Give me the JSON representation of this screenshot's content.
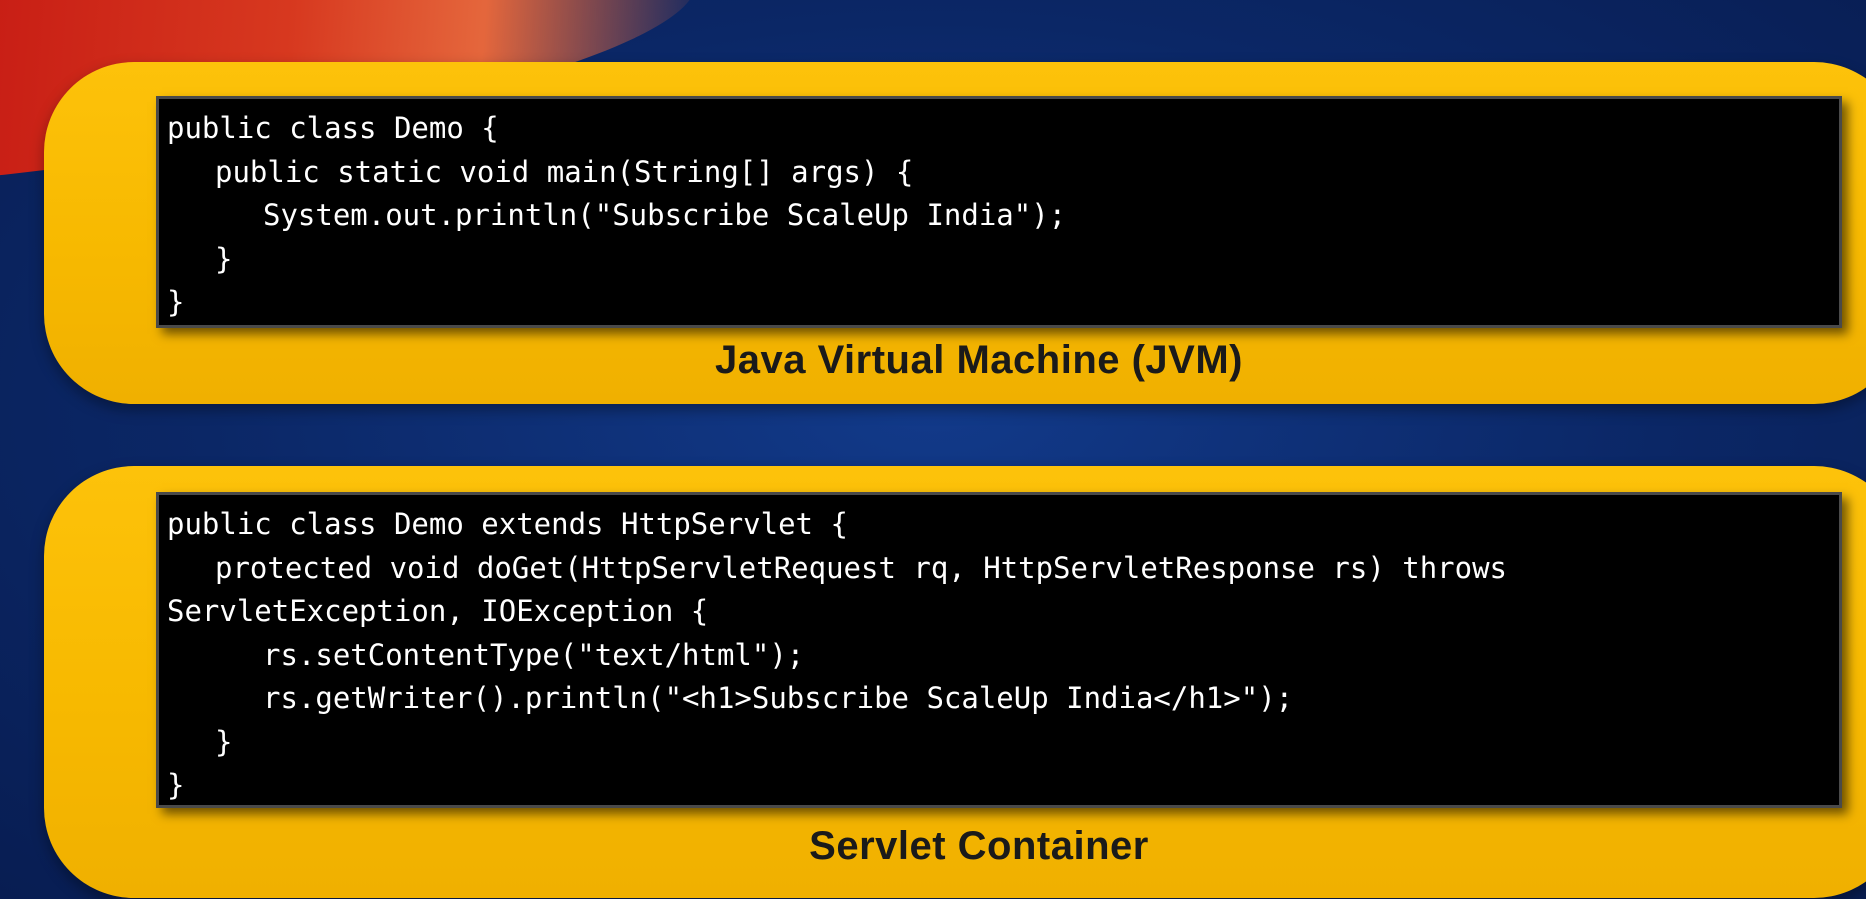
{
  "slide": {
    "jvm_panel": {
      "caption": "Java Virtual Machine (JVM)",
      "code_lines": [
        "public class Demo {",
        "public static void main(String[] args) {",
        "System.out.println(\"Subscribe ScaleUp India\");",
        "}",
        "}"
      ]
    },
    "servlet_panel": {
      "caption": "Servlet Container",
      "code_lines": [
        "public class Demo extends HttpServlet {",
        "protected void doGet(HttpServletRequest rq, HttpServletResponse rs) throws",
        "ServletException, IOException {",
        "rs.setContentType(\"text/html\");",
        "rs.getWriter().println(\"<h1>Subscribe ScaleUp India</h1>\");",
        "}",
        "}"
      ]
    },
    "colors": {
      "background": "#0d2a6c",
      "panel": "#fdc20a",
      "code_background": "#000000",
      "code_text": "#ffffff",
      "caption_text": "#1a1a1a",
      "accent_red": "#d01a10"
    }
  }
}
